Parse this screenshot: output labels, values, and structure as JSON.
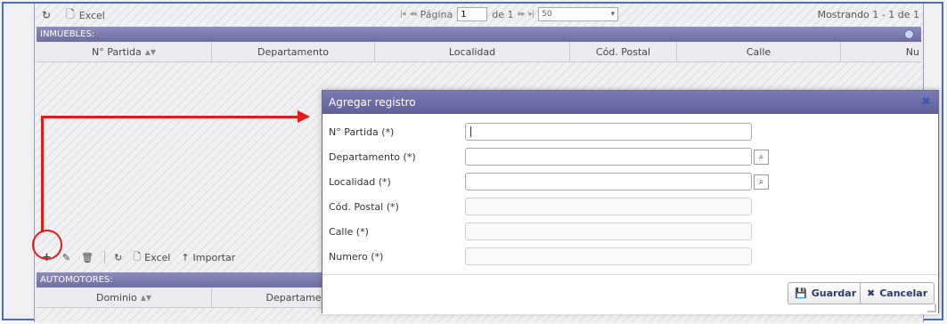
{
  "top_toolbar": {
    "refresh_icon": "refresh-icon",
    "excel_label": "Excel",
    "page_label": "Página",
    "page_value": "1",
    "of_label": "de 1",
    "page_size": "50",
    "showing": "Mostrando 1 - 1 de 1"
  },
  "inmuebles": {
    "title": "INMUEBLES:",
    "columns": [
      "N° Partida",
      "Departamento",
      "Localidad",
      "Cód. Postal",
      "Calle",
      "Nu"
    ]
  },
  "bottom_toolbar": {
    "add_icon": "plus-icon",
    "edit_icon": "pencil-icon",
    "delete_icon": "trash-icon",
    "refresh_icon": "refresh-icon",
    "excel_label": "Excel",
    "import_label": "Importar"
  },
  "automotores": {
    "title": "AUTOMOTORES:",
    "columns": [
      "Dominio",
      "Departame"
    ]
  },
  "dialog": {
    "title": "Agregar registro",
    "fields": [
      {
        "label": "N° Partida (*)",
        "value": ""
      },
      {
        "label": "Departamento (*)",
        "value": ""
      },
      {
        "label": "Localidad (*)",
        "value": ""
      },
      {
        "label": "Cód. Postal (*)",
        "value": ""
      },
      {
        "label": "Calle (*)",
        "value": ""
      },
      {
        "label": "Numero (*)",
        "value": ""
      }
    ],
    "save_label": "Guardar",
    "cancel_label": "Cancelar"
  },
  "colors": {
    "header": "#6d6da3",
    "annotation": "#e01b1b",
    "frame": "#4a6fb5"
  }
}
